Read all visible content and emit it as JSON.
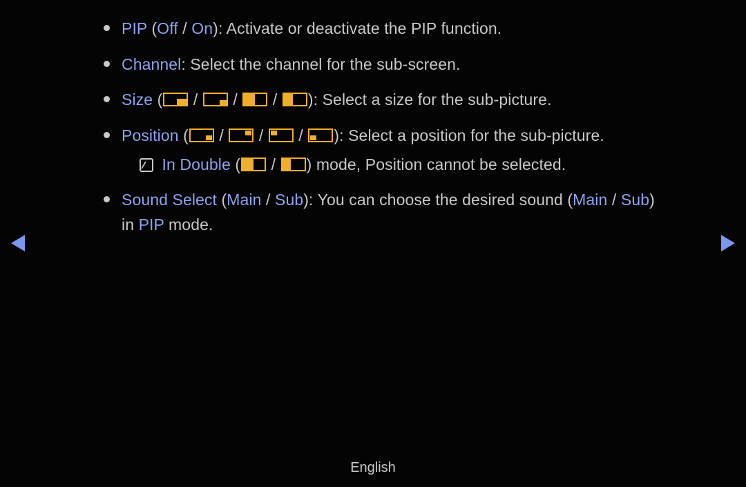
{
  "items": {
    "pip": {
      "label": "PIP",
      "off": "Off",
      "on": "On",
      "desc": ": Activate or deactivate the PIP function."
    },
    "channel": {
      "label": "Channel",
      "desc": ": Select the channel for the sub-screen."
    },
    "size": {
      "label": "Size",
      "desc": ": Select a size for the sub-picture."
    },
    "position": {
      "label": "Position",
      "desc": ": Select a position for the sub-picture."
    },
    "note": {
      "lead": "In Double",
      "tail": " mode, Position cannot be selected."
    },
    "sound": {
      "label": "Sound Select",
      "main": "Main",
      "sub": "Sub",
      "desc_lead": ": You can choose the desired sound (",
      "desc_mid": " / ",
      "desc_tail": ") in ",
      "pip": "PIP",
      "desc_end": " mode."
    }
  },
  "sep": {
    "open": " (",
    "close": ")",
    "slash": " / "
  },
  "footer": "English"
}
